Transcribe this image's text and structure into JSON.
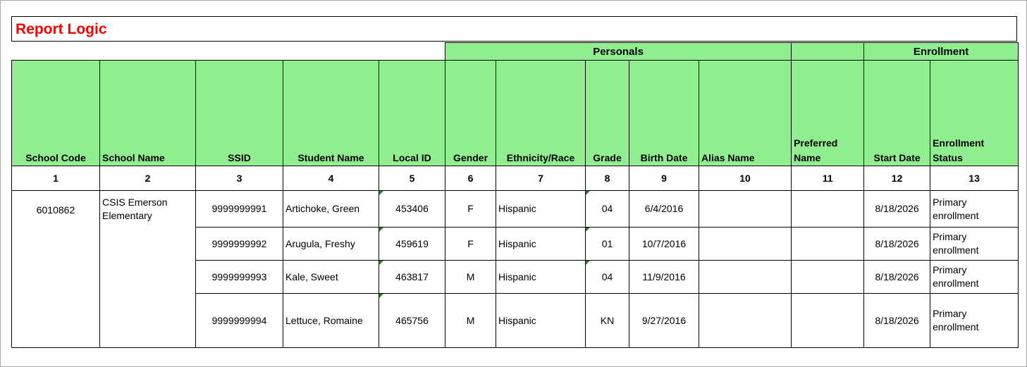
{
  "title": "Report Logic",
  "groups": {
    "personals": "Personals",
    "enrollment": "Enrollment"
  },
  "headers": {
    "school_code": "School Code",
    "school_name": "School Name",
    "ssid": "SSID",
    "student_name": "Student Name",
    "local_id": "Local ID",
    "gender": "Gender",
    "ethnicity": "Ethnicity/Race",
    "grade": "Grade",
    "birth_date": "Birth Date",
    "alias_name": "Alias Name",
    "preferred_name_1": "Preferred",
    "preferred_name_2": "Name",
    "start_date": "Start Date",
    "enrollment_status_1": "Enrollment",
    "enrollment_status_2": "Status"
  },
  "column_numbers": [
    "1",
    "2",
    "3",
    "4",
    "5",
    "6",
    "7",
    "8",
    "9",
    "10",
    "11",
    "12",
    "13"
  ],
  "school": {
    "code": "6010862",
    "name_line1": "CSIS Emerson",
    "name_line2": "Elementary"
  },
  "rows": [
    {
      "ssid": "9999999991",
      "student_name": "Artichoke, Green",
      "local_id": "453406",
      "gender": "F",
      "ethnicity": "Hispanic",
      "grade": "04",
      "birth_date": "6/4/2016",
      "alias_name": "",
      "preferred_name": "",
      "start_date": "8/18/2026",
      "status_1": "Primary",
      "status_2": "enrollment"
    },
    {
      "ssid": "9999999992",
      "student_name": "Arugula, Freshy",
      "local_id": "459619",
      "gender": "F",
      "ethnicity": "Hispanic",
      "grade": "01",
      "birth_date": "10/7/2016",
      "alias_name": "",
      "preferred_name": "",
      "start_date": "8/18/2026",
      "status_1": "Primary",
      "status_2": "enrollment"
    },
    {
      "ssid": "9999999993",
      "student_name": "Kale, Sweet",
      "local_id": "463817",
      "gender": "M",
      "ethnicity": "Hispanic",
      "grade": "04",
      "birth_date": "11/9/2016",
      "alias_name": "",
      "preferred_name": "",
      "start_date": "8/18/2026",
      "status_1": "Primary",
      "status_2": "enrollment"
    },
    {
      "ssid": "9999999994",
      "student_name": "Lettuce, Romaine",
      "local_id": "465756",
      "gender": "M",
      "ethnicity": "Hispanic",
      "grade": "KN",
      "birth_date": "9/27/2016",
      "alias_name": "",
      "preferred_name": "",
      "start_date": "8/18/2026",
      "status_1": "Primary",
      "status_2": "enrollment"
    }
  ],
  "colors": {
    "header_fill": "#90ee90",
    "accent_red": "#ff0000",
    "comment_marker": "#2e7d32"
  }
}
